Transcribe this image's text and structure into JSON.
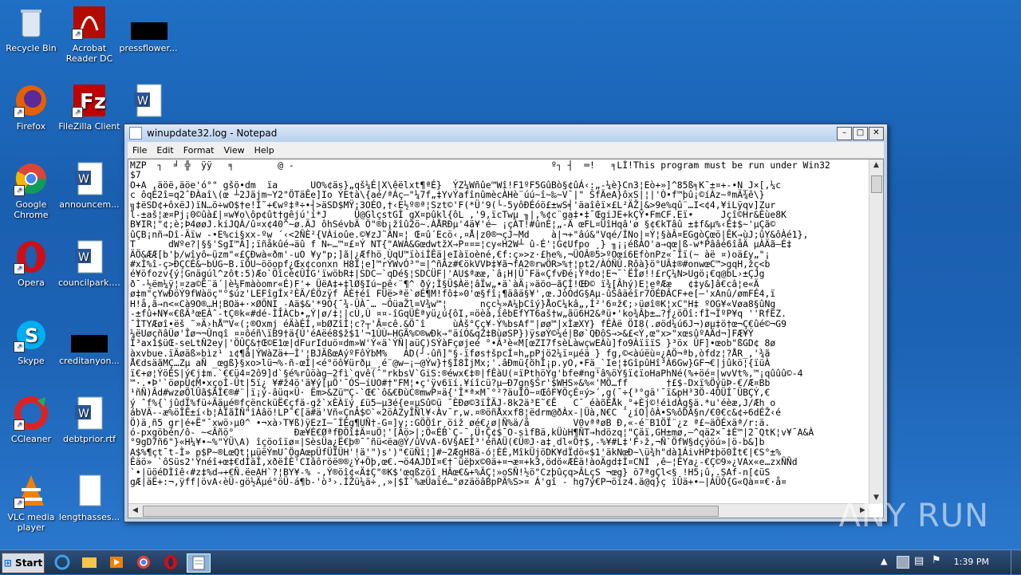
{
  "desktop": {
    "icons": [
      {
        "label": "Recycle Bin",
        "icon": "recycle-bin-icon"
      },
      {
        "label": "Acrobat Reader DC",
        "icon": "acrobat-icon"
      },
      {
        "label": "pressflower...",
        "icon": "file-icon"
      },
      {
        "label": "Firefox",
        "icon": "firefox-icon"
      },
      {
        "label": "FileZilla Client",
        "icon": "filezilla-icon"
      },
      {
        "label": "",
        "icon": "word-doc-icon"
      },
      {
        "label": "Google Chrome",
        "icon": "chrome-icon"
      },
      {
        "label": "announcem...",
        "icon": "word-doc-icon"
      },
      {
        "label": "Opera",
        "icon": "opera-icon"
      },
      {
        "label": "councilpark.rtf",
        "icon": "word-doc-icon"
      },
      {
        "label": "Skype",
        "icon": "skype-icon"
      },
      {
        "label": "creditanyon...",
        "icon": "file-icon"
      },
      {
        "label": "CCleaner",
        "icon": "ccleaner-icon"
      },
      {
        "label": "debtprior.rtf",
        "icon": "word-doc-icon"
      },
      {
        "label": "VLC media player",
        "icon": "vlc-icon"
      },
      {
        "label": "lengthasses...",
        "icon": "file-icon"
      }
    ]
  },
  "notepad": {
    "title": "winupdate32.log - Notepad",
    "menu": [
      "File",
      "Edit",
      "Format",
      "View",
      "Help"
    ],
    "content_lines": [
      "MZP  ┐  ╛ ╬  ÿÿ   ╕        @ ‑                                               º┐ ┤  ═!   ╕LÍ!This program must be run under Win32",
      "$7",
      "O+A ,äöë,äöe'ó°\" gšö•dm  ïa      UO%¢äs}„qš¼É|X\\êëlxt¶ªÉ}  ÝZ¼Wñûe™Wî!F1ºF5GûBò§¢ûÁ‹:„-¼è}Cn3¦Eò+»]^85ß╕K˜±¤+-•N_J×[,¼c",
      "c ôqÉ2î=q2ˆÐÀaî\\(œ ┴2Jäjm~Y2\"ÖTäÊe]Io ÝEtà\\{aé/ªÁç—\"¼7f„‡YvÝafînûmècÀHè¨úú~î~‰~V¯|\" ŠfÃeA}ôxS|¦|'Ò•f™þû¡©íÀz~ªmÄ¾ê\\}",
      "╗‡ëSD¢+ôxëJ)ïN…ö÷wO$†e!Í˜+€wº‡ª÷•┤>äSD$MŸ;3OÉO‚†‹E½º®ª¦Szt©'F(*Ü'9(└-5yôÐÉóö£±wS╡'äaîêï×£L²ÄŽ|&>9e%qû¨…I<¢4,¥iLÿqv]Zur",
      "l-±aš¦æ¤Pj¡0©ûà£|¤w¥o\\ôp¢ût†gêjú'í*J     Ü@GlçstGÌ gX¤pûkl{ôL ,'9,ïcTwµ ╖|,%¢c¨ga‡•‡¯ŒgiJE+kÇŸ•FmCF.Eï•     Jçî©Hr&Èùe8K",
      "B¥IR¦\"¢;è;Þ4øøJ.kíJQÀ/û¤x¢40^~ø.ÄJ ôhSévbÄ Ö\"®b¡žîû2ö~.ÀÅRÐµ'4ä¥'é― ¡çÀT!#ûnÈ¦„‑Ä œFL¤ÜîHqâ'ø §¢€kTâû ±‡f&µ%‹É‡$~'µÇã©",
      "ûÇB¡nñ→Dî-Äïw ‑•E%ci§xx-ºw ´‹<2ÑÈ²{VÀioûe.©¥zJ˜ÄN¤¦ Œ¤û´Ecö‹,¤Å|z0®¬çJ~Md    à|¬+\"âú&\"Vqé/ÍNo|¤Ý¦§àÂ¤EGgòÇœö|ÊK→ùJ;ûY&ôÀé1},",
      "T      dWºe?|§§'SgI™Ä];ïñåkûé→äû f N←…™¤£¤Ý NT{\"AWÀ&GœdwtžX→P¤¤=¦cy«H2W┴ û-É'¦G¢Ufpo ¸} ╖¡¡éßÀO'a→qœ|ß‑w*Pââé6îåÄ µÀÄã–É‡",
      "ÄÖ&ÆÆ[b'þ/wîyô←üzm\"«£ÇÐwà«ðm'-uO ¥y\"p;]ã|¿Æfhö¸ÙqU™ïòiÍÊä|eIàïoèné‚€f:ç»>z·£he%,¬ÜOÂ®5>ºOœí6EfònPz«¯Ïï(~ àë ¤)oä£y„\"¡",
      "#xÌ%î-ç>ÐÇCÉ&~bÚG~B.ïÖU~ööopf¿Œx¢conxn H8I¦e]™rÝWvÓ³\"=|^ñÃz#€ökVVÞ‡¥ã¬fA2®rwÖR>%†¦pt2/ÀÓÑÛ.Rôà}ö°UÂ‡®#onwœC™>gqH,žç<b",
      "é¥öfozv{ý¦Gnägúl^zôŧ:5)Æo`Öîcè¢ÛÍG'ïwöbR‡|SDC—`qDé§¦SDCÜF|'AU$ªææ‚`â¡H|ÜˆFä«ÇfvÐé¡Ýªdo¦E¬¯`ËÎø!!£rÇ¼N>Ugö¡€q@bL›±ÇJg",
      "ð¯‑½ëm¼ÿ¦¤za©Ê¨ä´|è¼Fmàòomr«É)F'+ ÜëA‡+‡lØ§Iú~pê‹¨¶^ ðý;Ì§Ü$Àë¦âÏw„•ä`àÄ¡»äöo–ãÇÍ!ŒÐ© ï¾[Âhý)E¦eªÆæ   ¢‡y&]â€câ¦e«Ä",
      "ø‡m\"çYwÐöÝ9fWàöç\"°$úz'LEFîgÍx²ÈÄ/ÉÖzÿf ÂÈ†éî FÜë>ªë`øÉ¶M!fô‡»0'œ§fî¡¶äâä§¥'‚œ.JòÓdG§Aµ‑ûŠâäéîr7ÕÉÐÂCF+e[—'xAnû/ømFÉ4,ï",
      "H!å,ã→n<«Cà9O®…H¦BOä+·×ØÖNI¸‑Aä$&'*9Ó{¯¾-ÜÀ¯… ~ÔüaŽl=V¾w™¦      nçc½»A¼þCîý}ÅoC¼kâ„,Í²'6¤ž€;›üøî®K¦xC\"H‡ ºOG¥«Vøa8§ûNg",
      "‑±fû+N¥«€ßÄ³œEÀˆ‑tÇ®k«#dé-ÌÌÀCb•„Ý|ø/‡¦|cÙ,Ù ¤¤-îGqÜÈªyü¿ú{ôI,¤öèà,îêbEfYT6aš†w„ãü6H2&ªü•'ko¾Âþ±…?ƒ¿öÖî:fÌ¬ÏºP¥q ''RfEZ.",
      "¯ÌTYÆøî•ëš ˜»Ä›hÅ™V«(;®Oxmj éÄàÉÍ,¤bØZîÌ¦c?┬'Â=cê.&Ö¯î     ùÀš°Çç¥-Ý%bsAf\"|øø™|xÌæXY} fÉÀë ÖI8(.øöd¼ú6J¬)øµ‡ö†œ¬Ç€ûé©¬G9",
      "¼ëUøçñâÜø'Îø¬¬Ûnqî ¤¤ôéñ\\ïB9†ä{Ú'éAëé8$ž$1'¬1ÙÙ←HGÃ%©®wÐk→\"äíÓ&qZ‡BùøSP})ÿsøÝ©¼é|Bø`QÐôS→>&£<Ý,œ\"x>\"xœsûºAÄd¬]FÆ¥Ý",
      "Ï³ax1$üŒ‑seLtÑ2ey|'ÖÛÇ&†Œ©E1œ|dFurIduö¤dm»W'Ý«ä`ÝÑ|aüÇ)SÝàFçøjeé °•Â³è«M[œZI7fsèLàwçwEÀù]fo9ÀïïïS }³öx ÛF]•œob\"ßGD¢ 8ø",
      "àxvbue.ïÄøäß»bìz¹ ı¢¶å|ÝWàZä+–Ì'¦BJÄßœAýºFôÝbM%   ÁD(┘‑ûñ]\"§‑ïføs†špcÍ¤h„pPjö2¼ï¤µéä } fg,©<àúëù¤¿AÖ¬ªb,òfdz¦?ÅR_,'¾ã",
      "Å€dsäãMÇ…Zµ aÑ _œgß}§xo>lü¬%‑ñ‑œÌ|<é°öô¥ürðµ_¸é¨@w—¡–@Ýw}†§Ì8ÌjMx;'.âÐmü{õhÍ¡p.yO,•Fä_`Ie¦‡GîpûHî³À6Gw}GF¬€|jûkö¦{ïüÀ",
      "ï€+ø¦ÝöÉS|ý€j‡m.`€€ü4¤2ô9]d`§é%rûöàg—2fì`qvê(ˆ\"rkbsV`GiS:®éwx€‡®|fÊàU(¤ïPthöÝg'bfe#ng¹â%öÝ§ï¢ïoHaPhNé(%+öé¤|wvVt%‚™¡qûûû©‑4",
      "™·.•Þ'`öøpÙ¢M•xçoÌ-Ût|5ï¿ ¥#ž4ö'ä¥ý[µÖ'¯ÓS—íUO#†\"FM¦•ç'ÿv6ïí.¥íîcü?µ—Ð7gn§Šr'$WHS»&%«'MÖ…ff       †£$-Dxï%ÖýüÞ‑€/Æ¤Bb",
      "¹ñÑ)Âd#wzøÖlÛã$ÃÎ€®#¨|ï¡ý‑âüq×Ü· Ëm>&Zü™Ç‑`Œ€`ô&€ÐùC®mwP¤ä{'Î*ª×M¯°²?äuÎÖ~¤ŒôF¥ÖçÉ¤ý>´,g(¯÷{³°gä'¯ï&pH³3Ö‑4ÓÜÍ¯ÜBÇÝ,€",
      "ý ˆf%{`jûdÏ%fü÷Ääµé®fçëncküË€çfä‑gž`xÈÀïý¸£ü5—µ3é{e¤µSû©ü ¯ÈÐø©3ïÎÄJ‑8k2ä³E˜€Ê   C¯ éàõÉÅk¸°+Èj©!éìdÀg§ä.*u'éèæ,J/Æh o",
      "ábVÄ‑‑æ%öÎÊ±í‹b¦ÀÏãÌÑ\"îÀâö!LP˜€[ä#ä'Vñ«ÇnÀ$©`«2öÀZyÎÑl¥‹Àv¯r,w.¤®öñÅxxf8¦ëdrm@ðÀx-|Üà,N€C ˆ¿íO|ôÀ•S%ôDÃ§n/€0€c&¢÷6dÉŽ‹é",
      "Ö)ä¸ñ5 gr|é+Ë\"¯xwö›µ0^ •¬xà›T¥ß)ÿEzI—¯ÍÉg¶UÑ†‑G¤]y;:GÖÖîr¸öiž øé€¿ø|Ñ%ä/å        V0vªªøB Ð,«‑é¨B1ÖÏ¨¿z ª£~äÖÉxäª/r:ä.",
      "ó‑pxgöbén/ô‑ ~<Âñö°           Ðæ¥É€ØªfÐÖî‡Ä¤uÖ¦'[Äö>|;Ö«ÉB`Ç-¯‚Ü↑Ç¢$¯O‑sìfBä‚kÜùH¶ÑT→hdözq¦\"Çäï‚GH±mø,—^qä2×¯‡É™|2¯QtK¦v¥¯A&À",
      "°9gD7ñ6\"}«H¼¥•~%\"ÝÜ\\A) îçöoîïø¤|SèsÜa¿Ë€þ®¯ˆñü<ëa@Ý/ûVvA‑6V§AEÌ³'éñAÜ(€Ü®J·a‡¸dl«Ö†$,‑%¥#L‡'F›ž,¬Ñ`ÖfW§dçýöú»|ö‑b&]b",
      "A$%¶çt¯t‑Ì» p$P~®LœQt¦µüëÝmUˆÖgAœpÜfÜÏÜH'!ä'\")s')\"€üÑî¦]#~2ÆgH8ä‑ó¦ÈÉ,MîkÜjöDK¥dÏdö«$1'äkNœÐ~\\ü¾h\"dà1ÁivHP‡þö0Ìt€|€S°±%",
      "Êäö» `ôSüs2'Ýnéî+œ‡€dÍäÎ,xðëÍÈ'CIâôröë®®¿Ý+Öþ,œ€.¬ö4AJDI¤€†¯üëþx©0ä+¤¬æ¤+k3,ödö«ÆÈä!àoÄgd‡Ì¤CNÌ ,ê—¦ÊYa¿-€Ç©9»¿VAx«e…zxÑÑd",
      "`•|üöéDÌîê‹#z‡%d→+€Ñ.ëeAH`?¦BY¥‑% ‑‚Ý®öî¢«Ä‡Ç\"®K$'œqßzöî¸HÂœ€&+%ÄÇ¦»oSÑ!½ö\"Czþûçq>ÂLçS ¬œg} ö7ªgÇl<§ !H5¡û,.SAf‑n[¢üS",
      "gÆ|äË+:¬,ÿff|övA‹èÜ-gö½Äµé°öÜ‑á¶b-'ò³›.ÍŽü¼ä÷¸,»|$Í`%æÜaïé…°øzäöâBpPÄ%S>¤ Á'gî - hg7ý€P¬öíz4.ä@q}ç ïÛä+•—|ÀÜÓ{G«Qà¤¤€·å¤"
    ]
  },
  "taskbar": {
    "start_label": "Start",
    "clock": "1:39 PM"
  },
  "watermark": "ANY RUN"
}
